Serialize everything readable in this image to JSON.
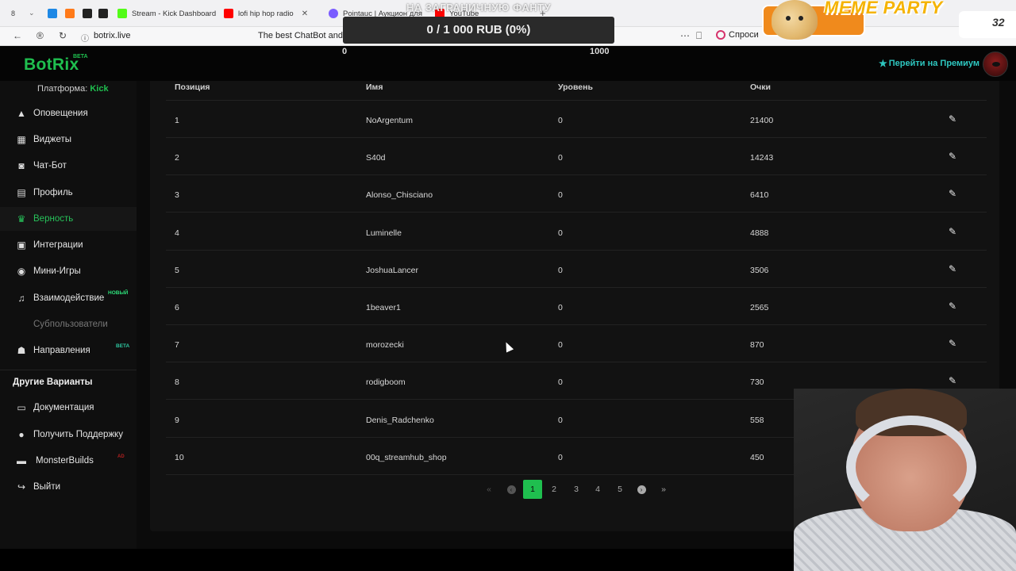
{
  "browser": {
    "tab_count": "8",
    "tabs": [
      {
        "label": "Stream - Kick Dashboard",
        "color": "#53fc18"
      },
      {
        "label": "lofi hip hop radio",
        "color": "#ff0000"
      },
      {
        "label": "Pointauc | Аукцион для с",
        "color": "#7a5cff"
      },
      {
        "label": "YouTube",
        "color": "#ff0000"
      }
    ],
    "url": "botrix.live",
    "page_title": "The best ChatBot and W",
    "ask_label": "Спроси"
  },
  "overlay": {
    "goal_caption": "НА ЗАГРАНИЧНУЮ ФАНТУ",
    "goal_text": "0 / 1 000 RUB (0%)",
    "goal_progress": 0,
    "goal_min": "0",
    "goal_max": "1000",
    "meme_title": "MEME PARTY",
    "meme_score": "32"
  },
  "header": {
    "logo": "BotRix",
    "logo_badge": "BETA",
    "premium_label": "Перейти на Премиум"
  },
  "sidebar": {
    "platform_label": "Платформа:",
    "platform_value": "Kick",
    "items": [
      {
        "label": "Оповещения",
        "icon": "warning-icon"
      },
      {
        "label": "Виджеты",
        "icon": "grid-icon"
      },
      {
        "label": "Чат-Бот",
        "icon": "robot-icon"
      },
      {
        "label": "Профиль",
        "icon": "id-card-icon"
      },
      {
        "label": "Верность",
        "icon": "trophy-icon"
      },
      {
        "label": "Интеграции",
        "icon": "plug-icon"
      },
      {
        "label": "Мини-Игры",
        "icon": "gamepad-icon"
      },
      {
        "label": "Взаимодействие",
        "icon": "music-icon",
        "badge": "НОВЫЙ"
      },
      {
        "label": "Субпользователи",
        "icon": "users-icon"
      },
      {
        "label": "Направления",
        "icon": "users-icon",
        "badge": "BETA"
      }
    ],
    "section_title": "Другие Варианты",
    "other_items": [
      {
        "label": "Документация",
        "icon": "doc-icon"
      },
      {
        "label": "Получить Поддержку",
        "icon": "question-icon"
      },
      {
        "label": "MonsterBuilds",
        "icon": "monitor-icon",
        "badge": "AD"
      },
      {
        "label": "Выйти",
        "icon": "logout-icon"
      }
    ],
    "active_color": "#27c25a"
  },
  "table": {
    "columns": [
      "Позиция",
      "Имя",
      "Уровень",
      "Очки"
    ],
    "rows": [
      {
        "position": "1",
        "name": "NoArgentum",
        "level": "0",
        "points": "21400"
      },
      {
        "position": "2",
        "name": "S40d",
        "level": "0",
        "points": "14243"
      },
      {
        "position": "3",
        "name": "Alonso_Chisciano",
        "level": "0",
        "points": "6410"
      },
      {
        "position": "4",
        "name": "Luminelle",
        "level": "0",
        "points": "4888"
      },
      {
        "position": "5",
        "name": "JoshuaLancer",
        "level": "0",
        "points": "3506"
      },
      {
        "position": "6",
        "name": "1beaver1",
        "level": "0",
        "points": "2565"
      },
      {
        "position": "7",
        "name": "morozecki",
        "level": "0",
        "points": "870"
      },
      {
        "position": "8",
        "name": "rodigboom",
        "level": "0",
        "points": "730"
      },
      {
        "position": "9",
        "name": "Denis_Radchenko",
        "level": "0",
        "points": "558"
      },
      {
        "position": "10",
        "name": "00q_streamhub_shop",
        "level": "0",
        "points": "450"
      }
    ]
  },
  "pagination": {
    "pages": [
      "1",
      "2",
      "3",
      "4",
      "5"
    ],
    "current": "1",
    "first": "«",
    "prev": "‹",
    "next": "›",
    "last": "»"
  }
}
